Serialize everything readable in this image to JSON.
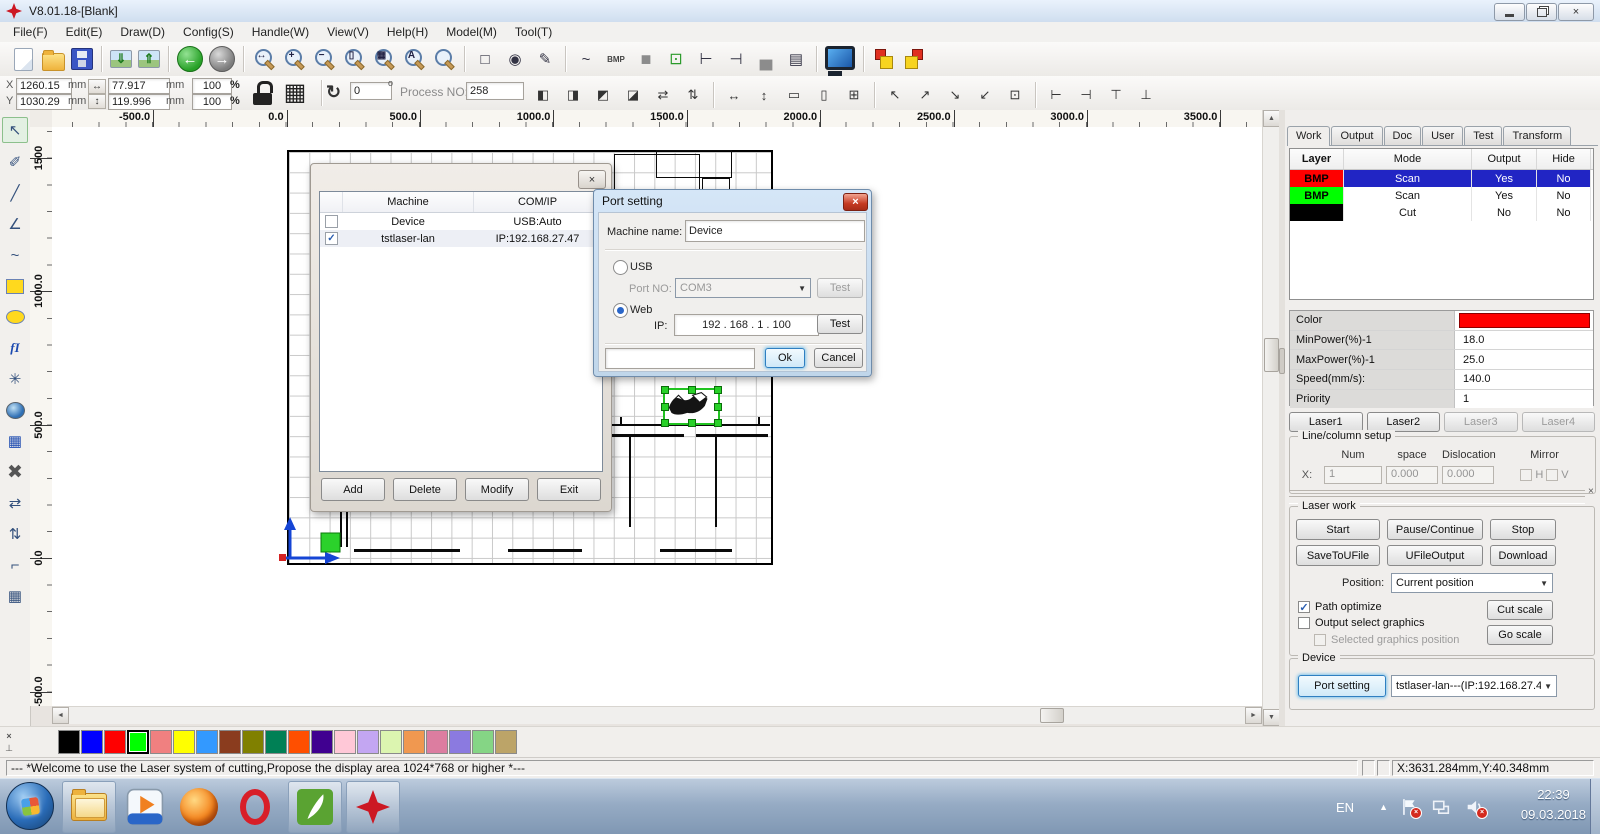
{
  "icons": {
    "close": "×",
    "check": "✓",
    "dropdown": "▼",
    "up": "▲",
    "down": "▼",
    "left": "◄",
    "right": "►",
    "dock": "⊥"
  },
  "window": {
    "title": "V8.01.18-[Blank]",
    "controls": {
      "close": "×"
    }
  },
  "menu": {
    "items": [
      "File(F)",
      "Edit(E)",
      "Draw(D)",
      "Config(S)",
      "Handle(W)",
      "View(V)",
      "Help(H)",
      "Model(M)",
      "Tool(T)"
    ]
  },
  "toolbar_main": {
    "icons": [
      {
        "name": "new-file-icon",
        "kind": "page"
      },
      {
        "name": "open-file-icon",
        "kind": "folder"
      },
      {
        "name": "save-file-icon",
        "kind": "floppy"
      },
      {
        "name": "separator"
      },
      {
        "name": "import-image-icon",
        "kind": "pic",
        "glyph": "⇓"
      },
      {
        "name": "export-image-icon",
        "kind": "pic",
        "glyph": "⇑"
      },
      {
        "name": "separator"
      },
      {
        "name": "undo-icon",
        "kind": "ball-green",
        "glyph": "←"
      },
      {
        "name": "redo-icon",
        "kind": "ball-gray",
        "glyph": "→"
      },
      {
        "name": "separator"
      },
      {
        "name": "zoom-pan-icon",
        "kind": "mag",
        "glyph": "↔"
      },
      {
        "name": "zoom-in-icon",
        "kind": "mag",
        "glyph": "+"
      },
      {
        "name": "zoom-out-icon",
        "kind": "mag",
        "glyph": "−"
      },
      {
        "name": "zoom-page-icon",
        "kind": "mag",
        "glyph": "▯"
      },
      {
        "name": "zoom-grid-icon",
        "kind": "mag",
        "glyph": "▦"
      },
      {
        "name": "zoom-all-icon",
        "kind": "mag",
        "glyph": "A"
      },
      {
        "name": "zoom-select-icon",
        "kind": "mag",
        "glyph": ""
      },
      {
        "name": "separator"
      },
      {
        "name": "select-frame-icon",
        "kind": "plain",
        "glyph": "□"
      },
      {
        "name": "rotate-node-icon",
        "kind": "plain",
        "glyph": "◉"
      },
      {
        "name": "pen-edit-icon",
        "kind": "plain",
        "glyph": "✎"
      },
      {
        "name": "separator"
      },
      {
        "name": "curve-icon",
        "kind": "plain",
        "glyph": "~"
      },
      {
        "name": "bmp-tool-icon",
        "kind": "text",
        "glyph": "BMP"
      },
      {
        "name": "fill-rect-icon",
        "kind": "plain-gray",
        "glyph": "■"
      },
      {
        "name": "node-connect-icon",
        "kind": "plain-green",
        "glyph": "⊡"
      },
      {
        "name": "size-width-icon",
        "kind": "plain",
        "glyph": "⊢"
      },
      {
        "name": "size-height-icon",
        "kind": "plain",
        "glyph": "⊣"
      },
      {
        "name": "machine-output-icon",
        "kind": "plain-gray",
        "glyph": "▄"
      },
      {
        "name": "param-list-icon",
        "kind": "plain",
        "glyph": "▤"
      },
      {
        "name": "separator"
      },
      {
        "name": "preview-monitor-icon",
        "kind": "monitor"
      },
      {
        "name": "separator"
      },
      {
        "name": "group-icon",
        "kind": "group"
      },
      {
        "name": "ungroup-icon",
        "kind": "group2"
      }
    ]
  },
  "toolbar_coords": {
    "x_label": "X",
    "y_label": "Y",
    "x_value": "1260.15",
    "y_value": "1030.29",
    "unit": "mm",
    "width_value": "77.917",
    "height_value": "119.996",
    "scale_x_value": "100",
    "scale_y_value": "100",
    "percent": "%",
    "h_arrow": "↔",
    "v_arrow": "↕",
    "grid_glyph": "▦",
    "rotate_glyph": "↻",
    "rotate_value": "0",
    "degree_glyph": "o",
    "process_label": "Process NO:",
    "process_value": "258",
    "align_icons": [
      {
        "name": "mirror-left-icon",
        "glyph": "◧"
      },
      {
        "name": "mirror-right-icon",
        "glyph": "◨"
      },
      {
        "name": "mirror-top-icon",
        "glyph": "◩"
      },
      {
        "name": "mirror-bottom-icon",
        "glyph": "◪"
      },
      {
        "name": "flip-horizontal-icon",
        "glyph": "⇄"
      },
      {
        "name": "flip-vertical-icon",
        "glyph": "⇅"
      },
      {
        "name": "separator"
      },
      {
        "name": "same-width-icon",
        "glyph": "↔"
      },
      {
        "name": "same-height-icon",
        "glyph": "↕"
      },
      {
        "name": "align-horizontal-icon",
        "glyph": "▭"
      },
      {
        "name": "align-vertical-icon",
        "glyph": "▯"
      },
      {
        "name": "align-grid-icon",
        "glyph": "⊞"
      },
      {
        "name": "separator"
      },
      {
        "name": "anchor-top-left-icon",
        "glyph": "↖"
      },
      {
        "name": "anchor-top-right-icon",
        "glyph": "↗"
      },
      {
        "name": "anchor-bottom-right-icon",
        "glyph": "↘"
      },
      {
        "name": "anchor-bottom-left-icon",
        "glyph": "↙"
      },
      {
        "name": "anchor-center-icon",
        "glyph": "⊡"
      },
      {
        "name": "separator"
      },
      {
        "name": "head-left-icon",
        "glyph": "⊢"
      },
      {
        "name": "head-right-icon",
        "glyph": "⊣"
      },
      {
        "name": "head-top-icon",
        "glyph": "⊤"
      },
      {
        "name": "head-bottom-icon",
        "glyph": "⊥"
      }
    ]
  },
  "left_toolbar": {
    "icons": [
      {
        "name": "select-tool-icon",
        "glyph": "↖",
        "active": true
      },
      {
        "name": "node-edit-tool-icon",
        "glyph": "✐"
      },
      {
        "name": "line-tool-icon",
        "glyph": "╱"
      },
      {
        "name": "polyline-tool-icon",
        "glyph": "∠"
      },
      {
        "name": "curve-tool-icon",
        "glyph": "~"
      },
      {
        "name": "rect-tool-icon",
        "kind": "rect-yellow"
      },
      {
        "name": "ellipse-tool-icon",
        "kind": "ellipse-yellow"
      },
      {
        "name": "text-tool-icon",
        "kind": "text-tool",
        "glyph": "fI"
      },
      {
        "name": "point-tool-icon",
        "glyph": "✳"
      },
      {
        "name": "camera-tool-icon",
        "kind": "camera"
      },
      {
        "name": "halftone-tool-icon",
        "kind": "halftone",
        "glyph": "▦"
      },
      {
        "name": "delete-tool-icon",
        "kind": "delete",
        "glyph": "✖"
      },
      {
        "name": "mirror-h-tool-icon",
        "glyph": "⇄"
      },
      {
        "name": "mirror-v-tool-icon",
        "glyph": "⇅"
      },
      {
        "name": "offset-tool-icon",
        "glyph": "⌐"
      },
      {
        "name": "array-tool-icon",
        "glyph": "▦"
      }
    ]
  },
  "rulers": {
    "top_labels": [
      "-500.0",
      "0.0",
      "500.0",
      "1000.0",
      "1500.0",
      "2000.0",
      "2500.0",
      "3000.0",
      "3500.0"
    ],
    "left_labels": [
      "1500",
      "1000.0",
      "500.0",
      "0.0",
      "-500.0"
    ]
  },
  "machine_dialog": {
    "columns": [
      "Machine",
      "COM/IP"
    ],
    "rows": [
      {
        "checked": false,
        "machine": "Device",
        "comip": "USB:Auto"
      },
      {
        "checked": true,
        "machine": "tstlaser-lan",
        "comip": "IP:192.168.27.47"
      }
    ],
    "buttons": [
      "Add",
      "Delete",
      "Modify",
      "Exit"
    ]
  },
  "port_dialog": {
    "title": "Port setting",
    "machine_name_label": "Machine name:",
    "machine_name_value": "Device",
    "usb_label": "USB",
    "port_no_label": "Port NO:",
    "port_no_value": "COM3",
    "test_label": "Test",
    "web_label": "Web",
    "ip_label": "IP:",
    "ip_value": "192  .  168  .  1  .  100",
    "ok_label": "Ok",
    "cancel_label": "Cancel"
  },
  "right_panel": {
    "tabs": [
      "Work",
      "Output",
      "Doc",
      "User",
      "Test",
      "Transform"
    ],
    "layer_table": {
      "headers": [
        "Layer",
        "Mode",
        "Output",
        "Hide"
      ],
      "rows": [
        {
          "layer": "BMP",
          "layer_color": "#ff0000",
          "mode": "Scan",
          "output": "Yes",
          "hide": "No",
          "selected": true
        },
        {
          "layer": "BMP",
          "layer_color": "#00ff00",
          "mode": "Scan",
          "output": "Yes",
          "hide": "No",
          "selected": false
        },
        {
          "layer": "",
          "layer_color": "#000000",
          "mode": "Cut",
          "output": "No",
          "hide": "No",
          "selected": false
        }
      ]
    },
    "properties": {
      "rows": [
        {
          "label": "Color",
          "swatch": "#ff0000"
        },
        {
          "label": "MinPower(%)-1",
          "value": "18.0"
        },
        {
          "label": "MaxPower(%)-1",
          "value": "25.0"
        },
        {
          "label": "Speed(mm/s):",
          "value": "140.0"
        },
        {
          "label": "Priority",
          "value": "1"
        }
      ]
    },
    "laser_buttons": [
      {
        "label": "Laser1",
        "enabled": true
      },
      {
        "label": "Laser2",
        "enabled": true
      },
      {
        "label": "Laser3",
        "enabled": false
      },
      {
        "label": "Laser4",
        "enabled": false
      }
    ],
    "line_column": {
      "title": "Line/column setup",
      "headers": [
        "Num",
        "space",
        "Dislocation",
        "Mirror"
      ],
      "row_label": "X:",
      "num_value": "1",
      "space_value": "0.000",
      "dislocation_value": "0.000",
      "h_label": "H",
      "v_label": "V"
    },
    "laser_work": {
      "title": "Laser work",
      "buttons_row1": [
        "Start",
        "Pause/Continue",
        "Stop"
      ],
      "buttons_row2": [
        "SaveToUFile",
        "UFileOutput",
        "Download"
      ],
      "position_label": "Position:",
      "position_value": "Current position",
      "path_optimize_label": "Path optimize",
      "path_optimize_checked": true,
      "output_select_label": "Output select graphics",
      "output_select_checked": false,
      "selected_graphics_label": "Selected graphics position",
      "cut_scale_label": "Cut scale",
      "go_scale_label": "Go scale"
    },
    "device": {
      "title": "Device",
      "port_setting_label": "Port setting",
      "device_value": "tstlaser-lan---(IP:192.168.27.4"
    }
  },
  "palette": {
    "colors": [
      "#000000",
      "#0000ff",
      "#ff0000",
      "#00ff00",
      "#f08080",
      "#ffff00",
      "#3399ff",
      "#8a3c1e",
      "#808000",
      "#008055",
      "#ff4f00",
      "#400090",
      "#ffc8d7",
      "#c3a6f2",
      "#dcf5b0",
      "#f09850",
      "#dc7da0",
      "#8b7ae0",
      "#85d585",
      "#bca468"
    ],
    "selected_index": 3
  },
  "status_bar": {
    "message": "--- *Welcome to use the Laser system of cutting,Propose the display area 1024*768 or higher *---",
    "coords": "X:3631.284mm,Y:40.348mm"
  },
  "taskbar": {
    "language": "EN",
    "time": "22:39",
    "date": "09.03.2018",
    "opera_glyph": "O"
  }
}
